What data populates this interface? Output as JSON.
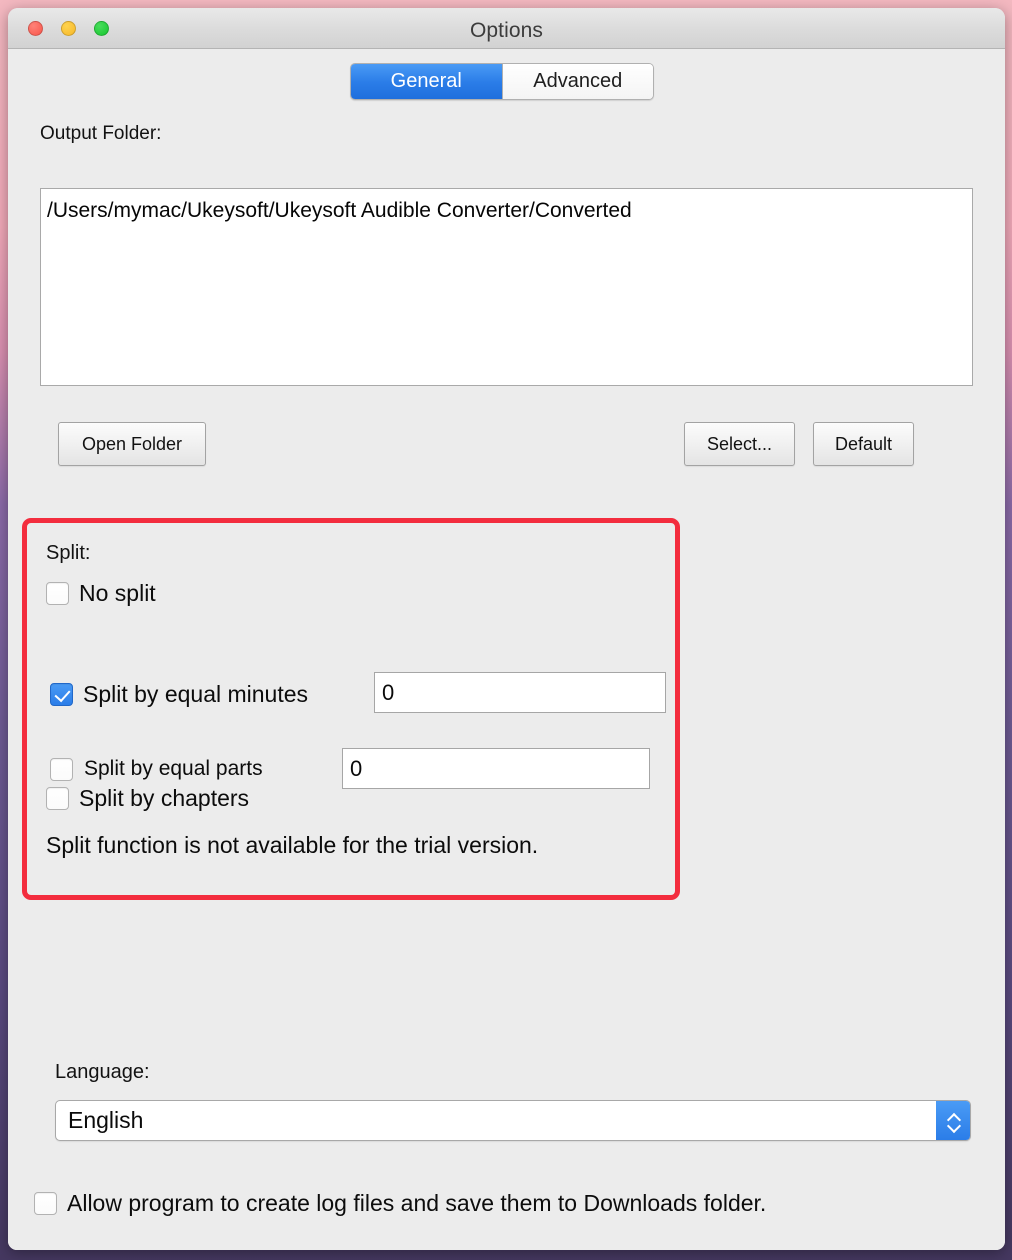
{
  "window": {
    "title": "Options",
    "traffic_lights": [
      "close",
      "minimize",
      "maximize"
    ]
  },
  "tabs": [
    {
      "label": "General",
      "selected": true
    },
    {
      "label": "Advanced",
      "selected": false
    }
  ],
  "output_folder": {
    "label": "Output Folder:",
    "path": "/Users/mymac/Ukeysoft/Ukeysoft Audible Converter/Converted"
  },
  "buttons": {
    "open_folder": "Open Folder",
    "select": "Select...",
    "default": "Default"
  },
  "split": {
    "label": "Split:",
    "highlight_color": "#f32d3e",
    "options": [
      {
        "label": "No split",
        "checked": false,
        "has_field": false
      },
      {
        "label": "Split by equal minutes",
        "checked": true,
        "has_field": true,
        "value": "0"
      },
      {
        "label": "Split by equal parts",
        "checked": false,
        "has_field": true,
        "value": "0"
      },
      {
        "label": "Split by chapters",
        "checked": false,
        "has_field": false
      }
    ],
    "notice": "Split function is not available for the trial version."
  },
  "language": {
    "label": "Language:",
    "selected": "English"
  },
  "logging": {
    "label": "Allow program to create log files and save them to Downloads folder.",
    "checked": false
  },
  "colors": {
    "accent_blue": "#2b7de8",
    "window_bg": "#ececec",
    "highlight_red": "#f32d3e"
  }
}
